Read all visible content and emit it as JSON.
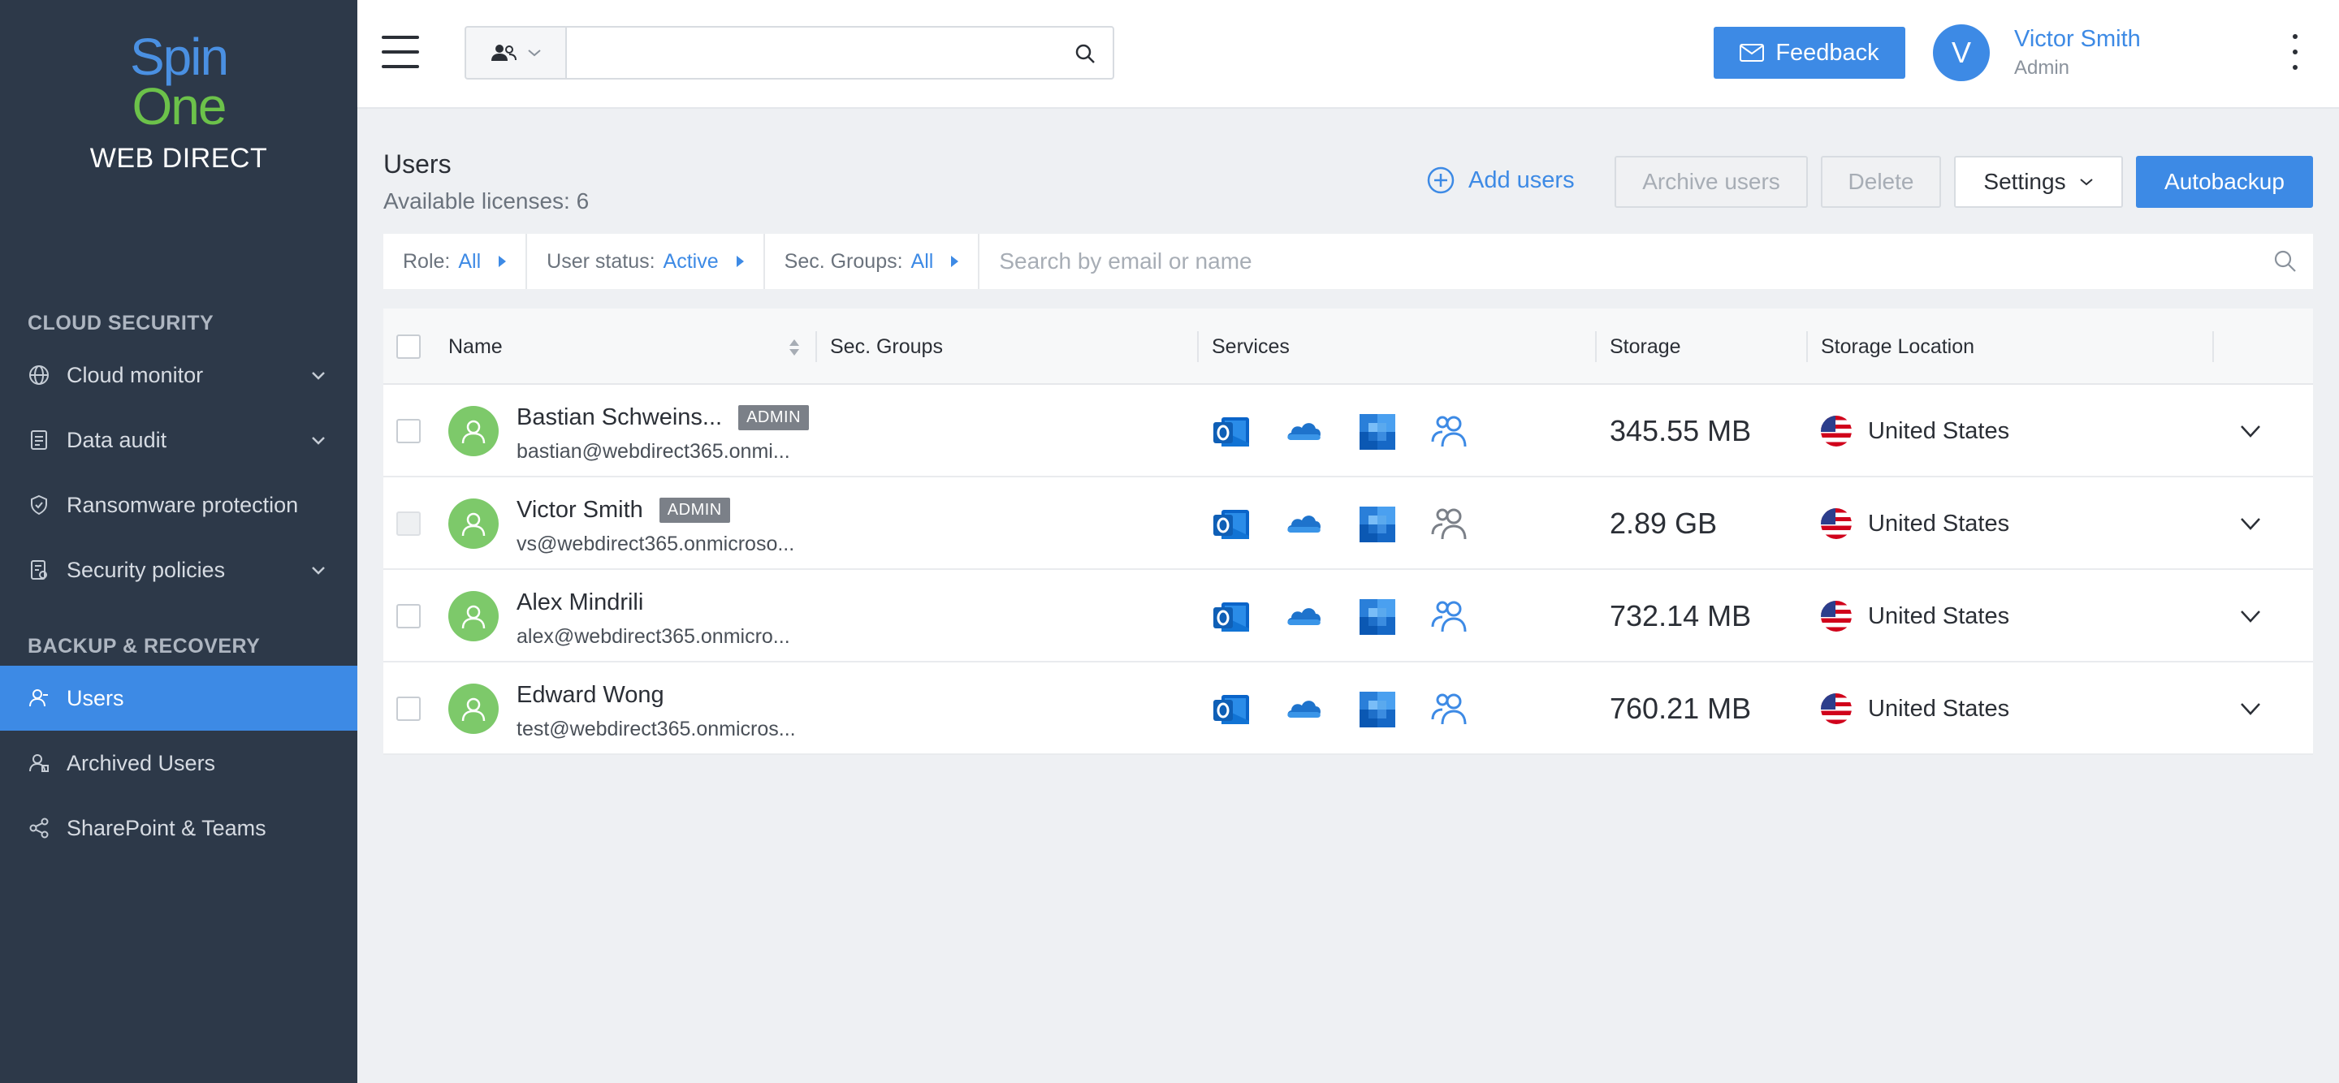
{
  "sidebar": {
    "logo": {
      "spin": "Spin",
      "one": "One",
      "brand": "WEB DIRECT"
    },
    "sections": [
      {
        "title": "CLOUD SECURITY"
      },
      {
        "title": "BACKUP & RECOVERY"
      }
    ],
    "items": [
      {
        "label": "Cloud monitor",
        "icon": "globe-icon",
        "expandable": true
      },
      {
        "label": "Data audit",
        "icon": "document-icon",
        "expandable": true
      },
      {
        "label": "Ransomware protection",
        "icon": "shield-icon",
        "expandable": false
      },
      {
        "label": "Security policies",
        "icon": "policy-icon",
        "expandable": true
      },
      {
        "label": "Users",
        "icon": "users-icon",
        "active": true
      },
      {
        "label": "Archived Users",
        "icon": "archived-users-icon"
      },
      {
        "label": "SharePoint & Teams",
        "icon": "share-icon"
      }
    ]
  },
  "topbar": {
    "search_value": "",
    "feedback_label": "Feedback",
    "user": {
      "initial": "V",
      "name": "Victor Smith",
      "role": "Admin"
    }
  },
  "page": {
    "title": "Users",
    "licenses": "Available licenses: 6",
    "actions": {
      "add_users": "Add users",
      "archive_users": "Archive users",
      "delete": "Delete",
      "settings": "Settings",
      "autobackup": "Autobackup"
    }
  },
  "filters": {
    "role": {
      "label": "Role:",
      "value": "All"
    },
    "status": {
      "label": "User status:",
      "value": "Active"
    },
    "groups": {
      "label": "Sec. Groups:",
      "value": "All"
    },
    "search_placeholder": "Search by email or name"
  },
  "table": {
    "columns": {
      "name": "Name",
      "groups": "Sec. Groups",
      "services": "Services",
      "storage": "Storage",
      "location": "Storage Location"
    },
    "rows": [
      {
        "name": "Bastian Schweins...",
        "admin": "ADMIN",
        "email": "bastian@webdirect365.onmi...",
        "storage": "345.55 MB",
        "location": "United States",
        "teams_active": true
      },
      {
        "name": "Victor Smith",
        "admin": "ADMIN",
        "email": "vs@webdirect365.onmicroso...",
        "storage": "2.89 GB",
        "location": "United States",
        "teams_active": false
      },
      {
        "name": "Alex Mindrili",
        "admin": "",
        "email": "alex@webdirect365.onmicro...",
        "storage": "732.14 MB",
        "location": "United States",
        "teams_active": true
      },
      {
        "name": "Edward Wong",
        "admin": "",
        "email": "test@webdirect365.onmicros...",
        "storage": "760.21 MB",
        "location": "United States",
        "teams_active": true
      }
    ]
  },
  "colors": {
    "accent": "#3d8ae5",
    "sidebar": "#2d3949",
    "avatar": "#7dc96a",
    "spin": "#4a90e2",
    "one": "#6cc24a"
  }
}
